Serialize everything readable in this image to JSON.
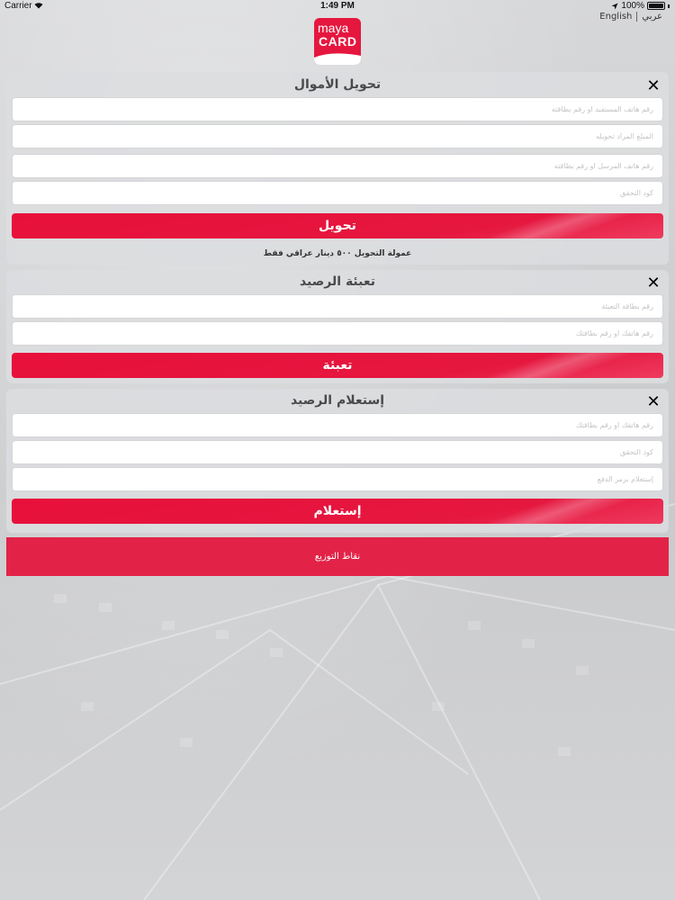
{
  "status_bar": {
    "carrier": "Carrier",
    "time": "1:49 PM",
    "battery": "100%"
  },
  "language": {
    "english": "English",
    "arabic": "عربي"
  },
  "logo": {
    "line1": "maya",
    "line2": "CARD"
  },
  "transfer": {
    "title": "تحويل الأموال",
    "fields": [
      "رقم هاتف المستفيد او رقم بطاقته",
      "المبلغ المراد تحويله",
      "رقم هاتف المرسل او رقم بطاقته",
      "كود التحقق"
    ],
    "button": "تحويل",
    "fee_note": "عمولة التحويل ٥٠٠ دينار عراقي فقط"
  },
  "topup": {
    "title": "تعبئة الرصيد",
    "fields": [
      "رقم بطاقة التعبئة",
      "رقم هاتفك او رقم بطاقتك"
    ],
    "button": "تعبئة"
  },
  "inquiry": {
    "title": "إستعلام الرصيد",
    "fields": [
      "رقم هاتفك او رقم بطاقتك",
      "كود التحقق",
      "إستعلام برمز الدفع"
    ],
    "button": "إستعلام"
  },
  "distribution": {
    "label": "نقاط التوزيع"
  },
  "colors": {
    "brand_red": "#e5173f",
    "panel_bg": "#dcdddf"
  }
}
